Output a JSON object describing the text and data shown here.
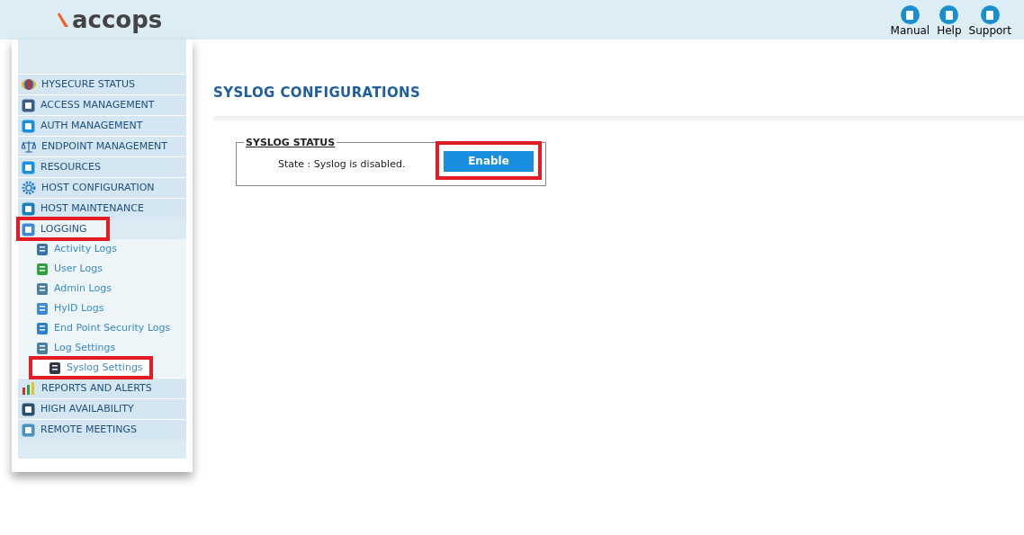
{
  "header": {
    "logo": "accops",
    "links": [
      {
        "label": "Manual"
      },
      {
        "label": "Help"
      },
      {
        "label": "Support"
      }
    ]
  },
  "sidebar": {
    "items": [
      {
        "label": "HYSECURE STATUS",
        "expanded": false,
        "highlighted": false
      },
      {
        "label": "ACCESS MANAGEMENT",
        "expanded": false,
        "highlighted": false
      },
      {
        "label": "AUTH MANAGEMENT",
        "expanded": false,
        "highlighted": false
      },
      {
        "label": "ENDPOINT MANAGEMENT",
        "expanded": false,
        "highlighted": false
      },
      {
        "label": "RESOURCES",
        "expanded": false,
        "highlighted": false
      },
      {
        "label": "HOST CONFIGURATION",
        "expanded": false,
        "highlighted": false
      },
      {
        "label": "HOST MAINTENANCE",
        "expanded": false,
        "highlighted": false
      },
      {
        "label": "LOGGING",
        "expanded": true,
        "highlighted": true,
        "children": [
          {
            "label": "Activity Logs",
            "selected": false,
            "highlighted": false
          },
          {
            "label": "User Logs",
            "selected": false,
            "highlighted": false
          },
          {
            "label": "Admin Logs",
            "selected": false,
            "highlighted": false
          },
          {
            "label": "HyID Logs",
            "selected": false,
            "highlighted": false
          },
          {
            "label": "End Point Security Logs",
            "selected": false,
            "highlighted": false
          },
          {
            "label": "Log Settings",
            "selected": false,
            "highlighted": false
          },
          {
            "label": "Syslog Settings",
            "selected": true,
            "highlighted": true
          }
        ]
      },
      {
        "label": "REPORTS AND ALERTS",
        "expanded": false,
        "highlighted": false
      },
      {
        "label": "HIGH AVAILABILITY",
        "expanded": false,
        "highlighted": false
      },
      {
        "label": "REMOTE MEETINGS",
        "expanded": false,
        "highlighted": false
      }
    ]
  },
  "main": {
    "title": "SYSLOG CONFIGURATIONS",
    "panel": {
      "legend": "SYSLOG STATUS",
      "state_text": "State : Syslog is disabled.",
      "button": {
        "label": "Enable",
        "highlighted": true
      }
    }
  }
}
